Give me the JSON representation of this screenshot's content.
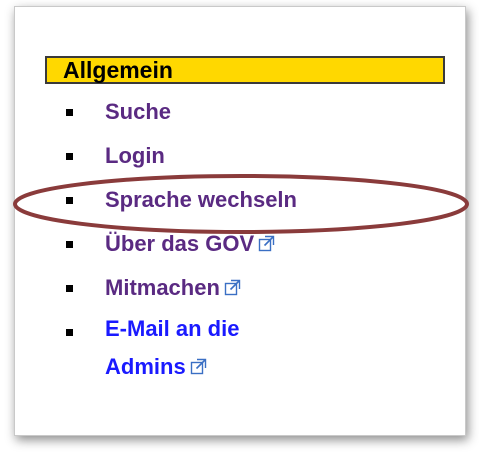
{
  "panel": {
    "title": "Allgemein",
    "items": [
      {
        "label": "Suche",
        "external": false,
        "style": "visited"
      },
      {
        "label": "Login",
        "external": false,
        "style": "visited"
      },
      {
        "label": "Sprache wechseln",
        "external": false,
        "style": "visited"
      },
      {
        "label": "Über das GOV",
        "external": true,
        "style": "visited"
      },
      {
        "label": "Mitmachen",
        "external": true,
        "style": "visited"
      },
      {
        "label_line1": "E-Mail an die",
        "label_line2": "Admins",
        "external": true,
        "style": "unvisited"
      }
    ]
  },
  "colors": {
    "header_bg": "#ffd800",
    "visited_link": "#5a2a82",
    "link": "#1a1aff",
    "highlight_ellipse": "#8a3b3b"
  },
  "icons": {
    "external": "external-link-icon",
    "bullet": "bullet-icon"
  }
}
